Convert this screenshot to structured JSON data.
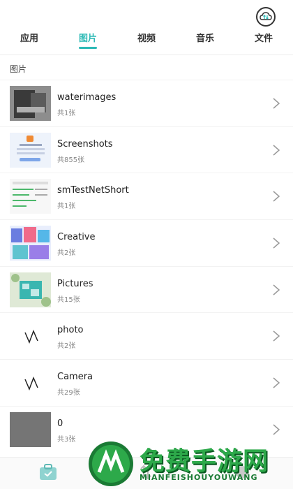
{
  "header": {
    "sync_icon": "cloud-sync-icon"
  },
  "tabs": [
    {
      "label": "应用"
    },
    {
      "label": "图片"
    },
    {
      "label": "视频"
    },
    {
      "label": "音乐"
    },
    {
      "label": "文件"
    }
  ],
  "active_tab": 1,
  "section": {
    "title": "图片"
  },
  "albums": [
    {
      "name": "waterimages",
      "count": "共1张"
    },
    {
      "name": "Screenshots",
      "count": "共855张"
    },
    {
      "name": "smTestNetShort",
      "count": "共1张"
    },
    {
      "name": "Creative",
      "count": "共2张"
    },
    {
      "name": "Pictures",
      "count": "共15张"
    },
    {
      "name": "photo",
      "count": "共2张"
    },
    {
      "name": "Camera",
      "count": "共29张"
    },
    {
      "name": "0",
      "count": "共3张"
    }
  ],
  "watermark": {
    "title": "免费手游网",
    "subtitle": "MIANFEISHOUYOUWANG"
  },
  "colors": {
    "accent": "#2bb9b5",
    "watermark": "#2da94a"
  }
}
